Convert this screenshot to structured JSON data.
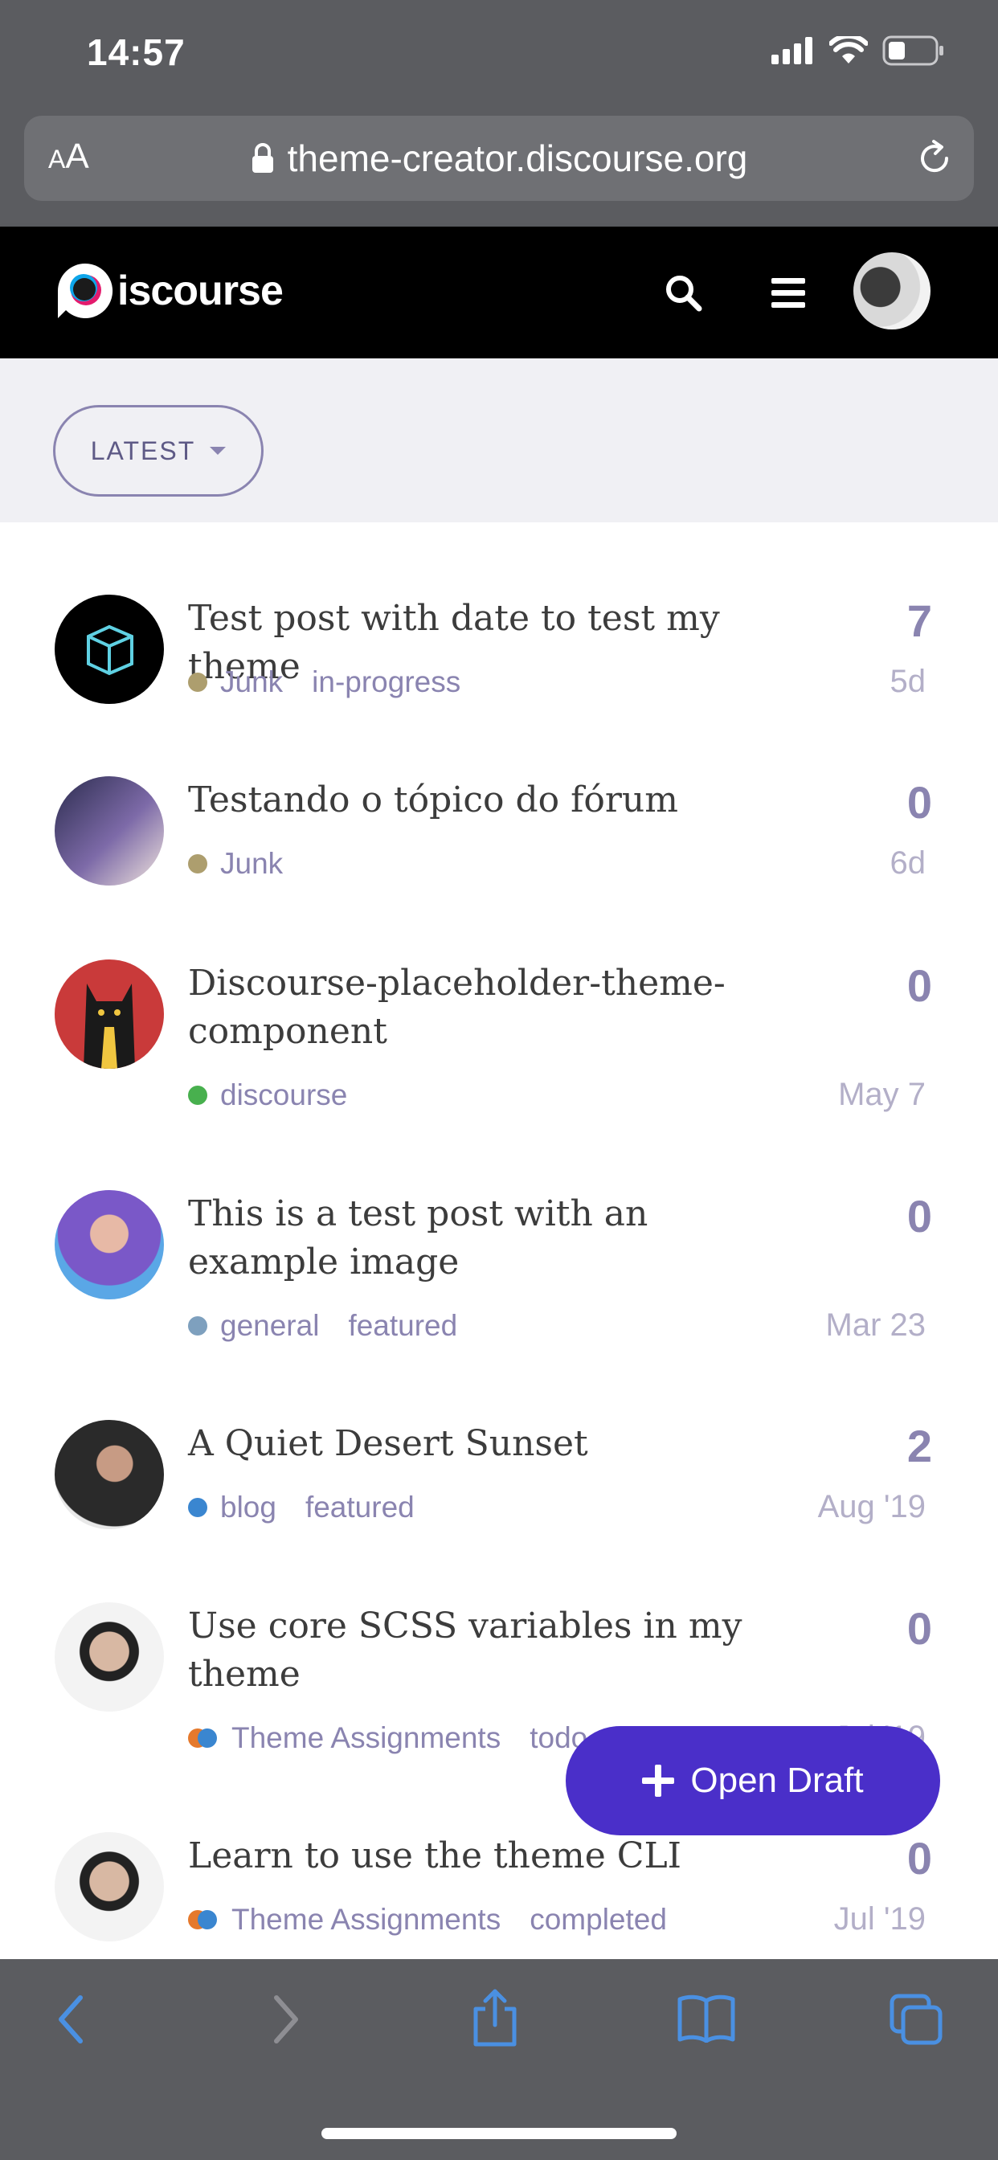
{
  "status_bar": {
    "time": "14:57"
  },
  "browser": {
    "text_size_small": "A",
    "text_size_large": "A",
    "url": "theme-creator.discourse.org"
  },
  "header": {
    "logo_text": "iscourse"
  },
  "nav": {
    "filter_label": "LATEST"
  },
  "topics": [
    {
      "title": "Test post with date to test my theme",
      "category": "Junk",
      "category_color": "#ad9e6e",
      "tags": [
        "in-progress"
      ],
      "replies": "7",
      "date": "5d"
    },
    {
      "title": "Testando o tópico do fórum",
      "category": "Junk",
      "category_color": "#ad9e6e",
      "tags": [],
      "replies": "0",
      "date": "6d"
    },
    {
      "title": "Discourse-placeholder-theme-component",
      "category": "discourse",
      "category_color": "#48b04e",
      "tags": [],
      "replies": "0",
      "date": "May 7"
    },
    {
      "title": "This is a test post with an example image",
      "category": "general",
      "category_color": "#7ea0be",
      "tags": [
        "featured"
      ],
      "replies": "0",
      "date": "Mar 23"
    },
    {
      "title": "A Quiet Desert Sunset",
      "category": "blog",
      "category_color": "#3a86d0",
      "tags": [
        "featured"
      ],
      "replies": "2",
      "date": "Aug '19"
    },
    {
      "title": "Use core SCSS variables in my theme",
      "category": "Theme Assignments",
      "category_color": "#3a86d0",
      "category_color2": "#e5792c",
      "tags": [
        "todo"
      ],
      "replies": "0",
      "date": "Jul '19"
    },
    {
      "title": "Learn to use the theme CLI",
      "category": "Theme Assignments",
      "category_color": "#3a86d0",
      "category_color2": "#e5792c",
      "tags": [
        "completed"
      ],
      "replies": "0",
      "date": "Jul '19"
    }
  ],
  "draft_button": {
    "label": "Open Draft"
  },
  "colors": {
    "accent": "#4a2fc9",
    "muted": "#8a84b0",
    "chrome": "#5b5c60"
  }
}
